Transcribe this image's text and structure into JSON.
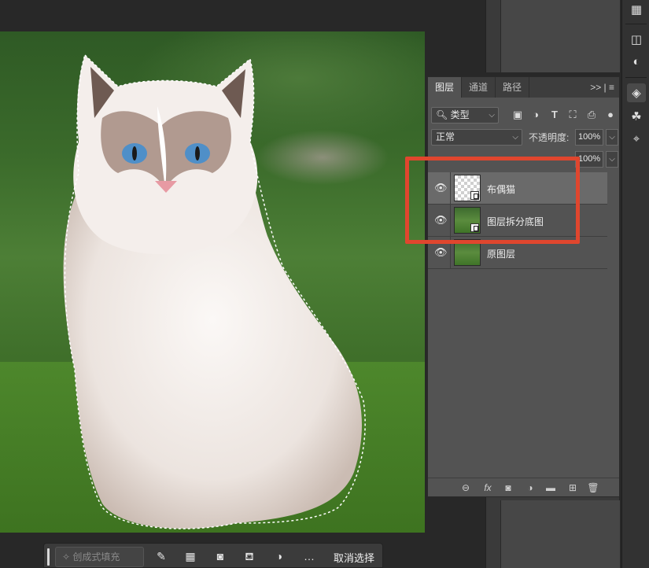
{
  "layers_panel": {
    "tabs": [
      {
        "label": "图层",
        "active": true
      },
      {
        "label": "通道",
        "active": false
      },
      {
        "label": "路径",
        "active": false
      }
    ],
    "tab_tools": ">> | ≡",
    "filter": {
      "label": "类型"
    },
    "blend_mode": "正常",
    "opacity_label": "不透明度:",
    "opacity_value": "100%",
    "fill_value": "100%",
    "layers": [
      {
        "name": "布偶猫",
        "visible": true,
        "selected": true,
        "thumb": "checker",
        "smart_object": true
      },
      {
        "name": "图层拆分底图",
        "visible": true,
        "selected": false,
        "thumb": "photo",
        "smart_object": true
      },
      {
        "name": "原图层",
        "visible": true,
        "selected": false,
        "thumb": "photo",
        "smart_object": false
      }
    ]
  },
  "taskbar": {
    "generative_fill_label": "创成式填充",
    "deselect_label": "取消选择",
    "more_icon": "…"
  },
  "colors": {
    "highlight": "#e0462e",
    "panel_bg": "#535353",
    "selected_row": "#6a6a6a"
  }
}
